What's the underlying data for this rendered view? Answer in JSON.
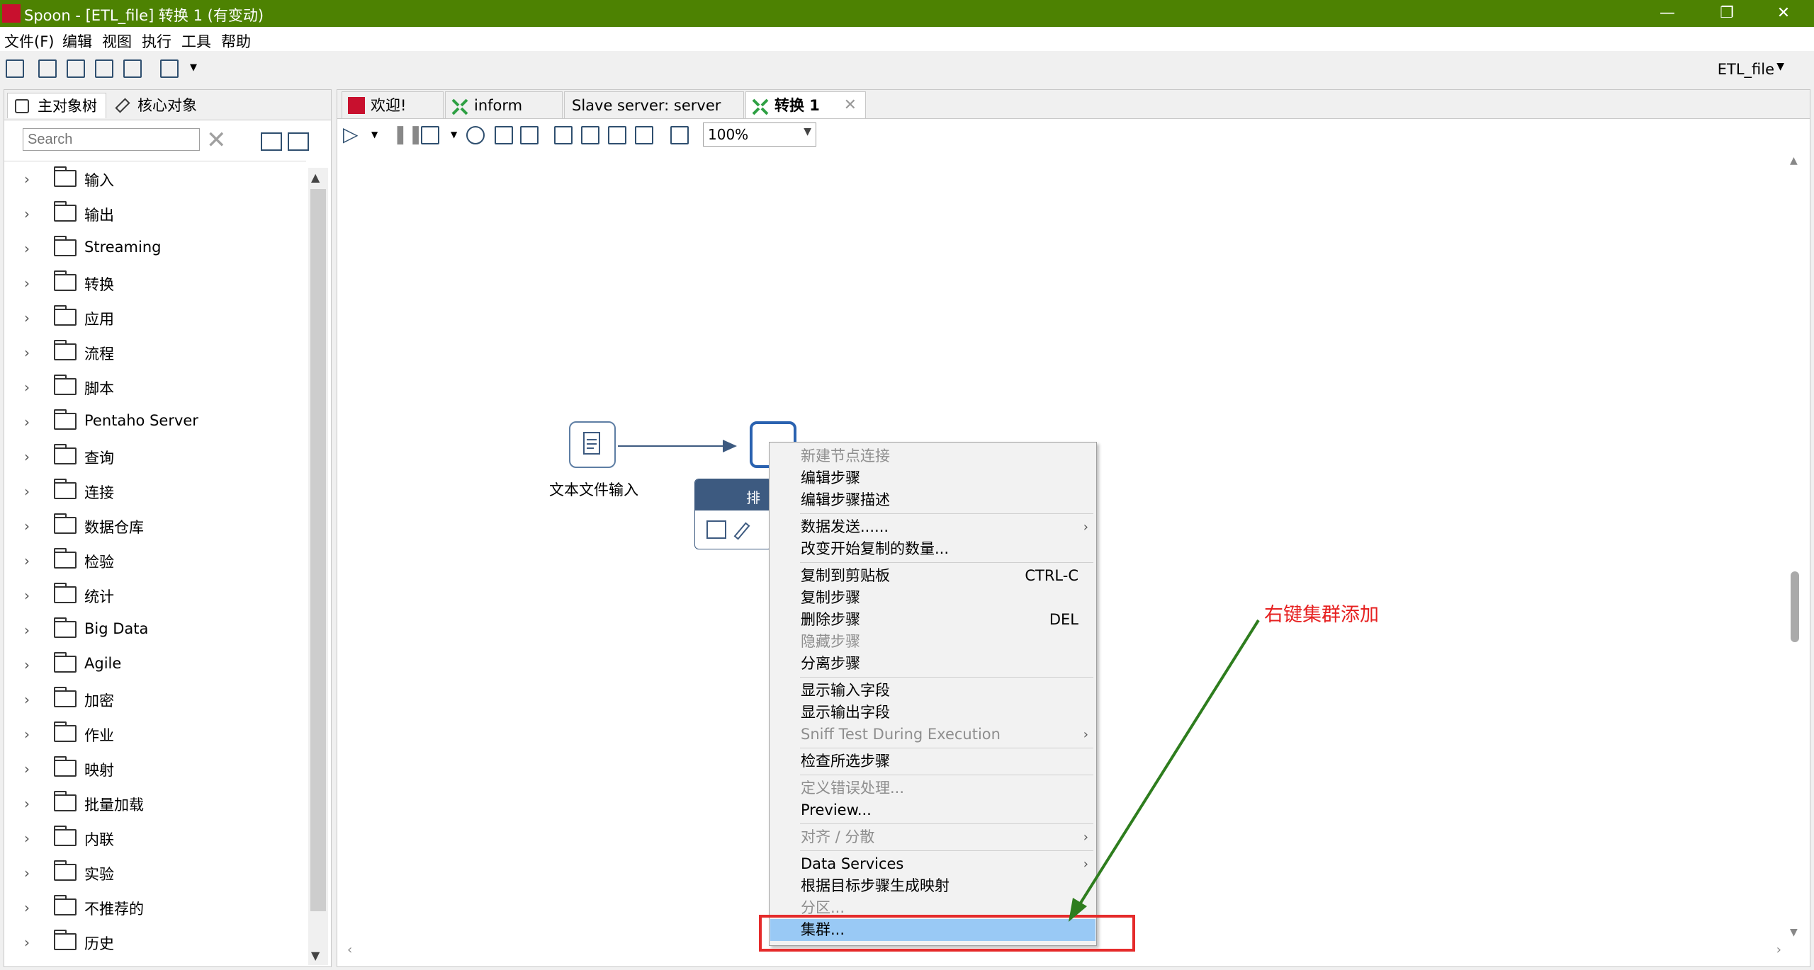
{
  "window": {
    "title": "Spoon - [ETL_file] 转换 1 (有变动)",
    "minimize_glyph": "—",
    "restore_glyph": "❐",
    "close_glyph": "✕"
  },
  "menubar": [
    "文件(F)",
    "编辑",
    "视图",
    "执行",
    "工具",
    "帮助"
  ],
  "perspective": {
    "label": "ETL_file",
    "arrow": "▼"
  },
  "left_panel": {
    "tabs": [
      "主对象树",
      "核心对象"
    ],
    "search": {
      "placeholder": "Search",
      "value": "Search"
    },
    "tree_items": [
      "输入",
      "输出",
      "Streaming",
      "转换",
      "应用",
      "流程",
      "脚本",
      "Pentaho Server",
      "查询",
      "连接",
      "数据仓库",
      "检验",
      "统计",
      "Big Data",
      "Agile",
      "加密",
      "作业",
      "映射",
      "批量加载",
      "内联",
      "实验",
      "不推荐的",
      "历史"
    ],
    "chevron_glyph": "›"
  },
  "editor": {
    "tabs": [
      {
        "label": "欢迎!",
        "icon": "spoon-icon"
      },
      {
        "label": "inform",
        "icon": "transformation-icon"
      },
      {
        "label": "Slave server: server",
        "icon": "none"
      },
      {
        "label": "转换 1",
        "icon": "transformation-icon",
        "active": true,
        "close": "✕"
      }
    ],
    "zoom": "100%",
    "zoom_arrow": "▼"
  },
  "canvas": {
    "steps": [
      {
        "label": "文本文件输入",
        "icon": "text-file-input-icon"
      },
      {
        "label": "排序",
        "icon": "sort-rows-icon"
      }
    ]
  },
  "context_menu": {
    "items": [
      {
        "label": "新建节点连接",
        "disabled": true
      },
      {
        "label": "编辑步骤"
      },
      {
        "label": "编辑步骤描述"
      },
      {
        "separator": true
      },
      {
        "label": "数据发送......",
        "submenu": true
      },
      {
        "label": "改变开始复制的数量..."
      },
      {
        "separator": true
      },
      {
        "label": "复制到剪贴板",
        "shortcut": "CTRL-C"
      },
      {
        "label": "复制步骤"
      },
      {
        "label": "删除步骤",
        "shortcut": "DEL"
      },
      {
        "label": "隐藏步骤",
        "disabled": true
      },
      {
        "label": "分离步骤"
      },
      {
        "separator": true
      },
      {
        "label": "显示输入字段"
      },
      {
        "label": "显示输出字段"
      },
      {
        "label": "Sniff Test During Execution",
        "disabled": true,
        "submenu": true
      },
      {
        "separator": true
      },
      {
        "label": "检查所选步骤"
      },
      {
        "separator": true
      },
      {
        "label": "定义错误处理...",
        "disabled": true
      },
      {
        "label": "Preview..."
      },
      {
        "separator": true
      },
      {
        "label": "对齐 / 分散",
        "disabled": true,
        "submenu": true
      },
      {
        "separator": true
      },
      {
        "label": "Data Services",
        "submenu": true
      },
      {
        "label": "根据目标步骤生成映射"
      },
      {
        "label": "分区...",
        "disabled": true
      },
      {
        "label": "集群...",
        "highlighted": true
      }
    ],
    "submenu_glyph": "›"
  },
  "annotation": {
    "text": "右键集群添加",
    "arrow_color": "#2e7d1e",
    "box_color": "#e52b2b"
  },
  "colors": {
    "titlebar": "#4d8202",
    "menu_highlight": "#99c9f5",
    "step_border": "#5e7ea4",
    "hop": "#3d5a80"
  }
}
